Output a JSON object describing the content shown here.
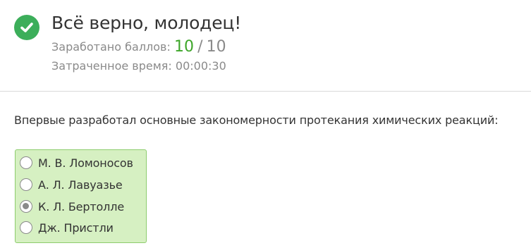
{
  "result": {
    "icon": "checkmark-icon",
    "title": "Всё верно, молодец!",
    "score_label": "Заработано баллов:",
    "score_value": "10",
    "score_separator": "/",
    "score_total": "10",
    "time_label": "Затраченное время:",
    "time_value": "00:00:30",
    "colors": {
      "success_green": "#3cae5a",
      "score_green": "#3ea62a",
      "answers_background": "#d6f0c2",
      "answers_border": "#8dcc6d"
    }
  },
  "question": {
    "text": "Впервые разработал основные закономерности протекания химических реакций:",
    "selected_index": 2,
    "options": [
      {
        "label": "М. В. Ломоносов",
        "checked": false
      },
      {
        "label": "А. Л. Лавуазье",
        "checked": false
      },
      {
        "label": "К. Л. Бертолле",
        "checked": true
      },
      {
        "label": "Дж. Пристли",
        "checked": false
      }
    ]
  }
}
